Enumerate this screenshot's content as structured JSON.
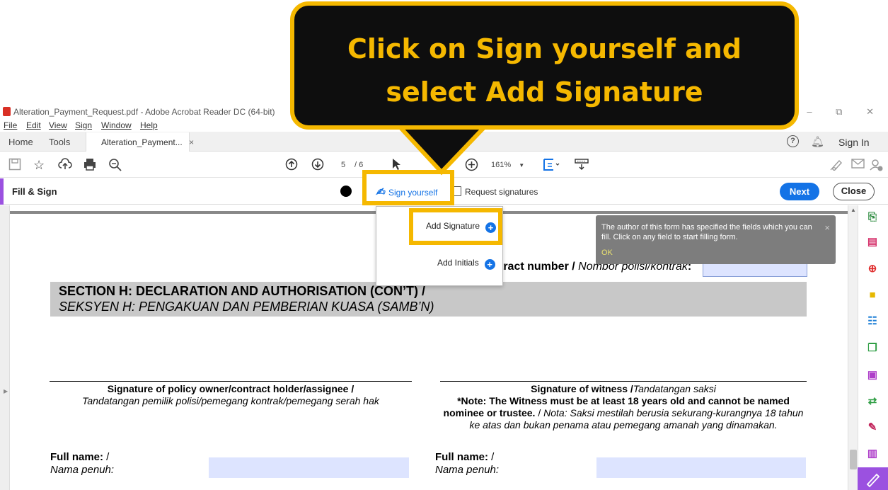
{
  "window": {
    "title": "Alteration_Payment_Request.pdf - Adobe Acrobat Reader DC (64-bit)",
    "controls": [
      "–",
      "⧉",
      "✕"
    ]
  },
  "menu": [
    "File",
    "Edit",
    "View",
    "Sign",
    "Window",
    "Help"
  ],
  "tabs": {
    "home": "Home",
    "tools": "Tools",
    "document": "Alteration_Payment...",
    "close": "×",
    "help": "?",
    "signin": "Sign In"
  },
  "toolbar": {
    "page_current": "5",
    "page_total": "/ 6",
    "zoom": "161%"
  },
  "fill_sign": {
    "label": "Fill & Sign",
    "sign_yourself": "Sign yourself",
    "request_signatures": "Request signatures",
    "next": "Next",
    "close": "Close"
  },
  "dropdown": {
    "add_signature": "Add Signature",
    "add_initials": "Add Initials"
  },
  "toast": {
    "message": "The author of this form has specified the fields which you can fill. Click on any field to start filling form.",
    "ok": "OK",
    "close": "×"
  },
  "document": {
    "contract_label_bold": "tract number / ",
    "contract_label_italic": "Nombor polisi/kontrak",
    "contract_colon": ":",
    "section_title": "SECTION H: DECLARATION AND AUTHORISATION (CON’T) /",
    "section_subtitle": "SEKSYEN H: PENGAKUAN DAN PEMBERIAN KUASA (SAMB’N)",
    "owner_sig_bold": "Signature of policy owner/contract holder/assignee /",
    "owner_sig_italic": "Tandatangan pemilik polisi/pemegang kontrak/pemegang serah hak",
    "witness_sig_bold": "Signature of witness /",
    "witness_sig_italic": "Tandatangan saksi",
    "witness_note_bold": "*Note: The Witness must be at least 18 years old and cannot be named nominee or trustee.",
    "witness_note_plain": " / ",
    "witness_note_italic": "Nota: Saksi mestilah berusia sekurang-kurangnya 18 tahun ke atas dan bukan penama atau pemegang amanah yang dinamakan.",
    "fullname_bold": "Full name:",
    "fullname_slash": " /",
    "fullname_italic": "Nama penuh:"
  },
  "callout": {
    "line1": "Click on Sign yourself and",
    "line2": "select Add Signature"
  },
  "colors": {
    "highlight": "#f5b800",
    "accent_blue": "#1473e6",
    "fill_sign_purple": "#9b51e0",
    "field_fill": "#dde4ff"
  },
  "icons": {
    "toolbar": [
      "save-icon",
      "bookmark-star-icon",
      "upload-cloud-icon",
      "print-icon",
      "zoom-search-icon",
      "page-up-icon",
      "page-down-icon",
      "select-cursor-icon",
      "zoom-in-icon",
      "fit-page-icon",
      "scroll-mode-icon",
      "sign-pen-icon",
      "email-icon",
      "add-user-icon"
    ],
    "right_panel": [
      "export-pdf-icon",
      "organize-pages-icon",
      "create-pdf-icon",
      "comment-icon",
      "scan-icon",
      "compress-icon",
      "edit-pdf-icon",
      "protect-icon",
      "fill-sign-icon",
      "more-tools-icon",
      "active-fill-sign-icon"
    ]
  }
}
